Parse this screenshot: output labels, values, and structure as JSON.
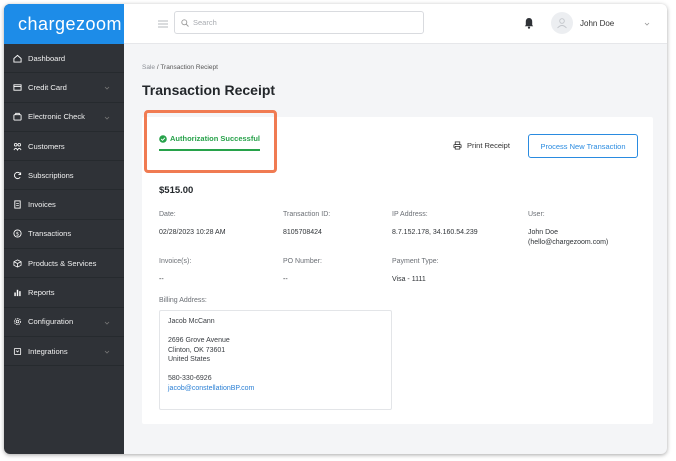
{
  "app": {
    "logo": "chargezoom"
  },
  "sidebar": {
    "items": [
      {
        "label": "Dashboard",
        "icon": "home-icon",
        "has_children": false
      },
      {
        "label": "Credit Card",
        "icon": "credit-card-icon",
        "has_children": true
      },
      {
        "label": "Electronic Check",
        "icon": "bank-icon",
        "has_children": true
      },
      {
        "label": "Customers",
        "icon": "customers-icon",
        "has_children": false
      },
      {
        "label": "Subscriptions",
        "icon": "refresh-icon",
        "has_children": false
      },
      {
        "label": "Invoices",
        "icon": "invoice-icon",
        "has_children": false
      },
      {
        "label": "Transactions",
        "icon": "dollar-icon",
        "has_children": false
      },
      {
        "label": "Products & Services",
        "icon": "box-icon",
        "has_children": false
      },
      {
        "label": "Reports",
        "icon": "bar-chart-icon",
        "has_children": false
      },
      {
        "label": "Configuration",
        "icon": "gear-icon",
        "has_children": true
      },
      {
        "label": "Integrations",
        "icon": "integrations-icon",
        "has_children": true
      }
    ]
  },
  "header": {
    "search_placeholder": "Search",
    "user_name": "John Doe"
  },
  "breadcrumb": {
    "root": "Sale",
    "separator": " / ",
    "current": "Transaction Reciept"
  },
  "page_title": "Transaction Receipt",
  "receipt": {
    "status": "Authorization Successful",
    "print_label": "Print Receipt",
    "process_label": "Process New Transaction",
    "amount": "$515.00",
    "fields": {
      "date_label": "Date:",
      "date": "02/28/2023 10:28 AM",
      "txn_label": "Transaction ID:",
      "txn": "8105708424",
      "ip_label": "IP Address:",
      "ip": "8.7.152.178, 34.160.54.239",
      "user_label": "User:",
      "user_line1": "John Doe",
      "user_line2": "(hello@chargezoom.com)",
      "invoice_label": "Invoice(s):",
      "invoice": "--",
      "po_label": "PO Number:",
      "po": "--",
      "payment_label": "Payment Type:",
      "payment": "Visa - 1111"
    },
    "billing": {
      "label": "Billing Address:",
      "name": "Jacob McCann",
      "street": "2696 Grove Avenue",
      "city": "Clinton, OK 73601",
      "country": "United States",
      "phone": "580-330-6926",
      "email": "jacob@constellationBP.com"
    }
  },
  "colors": {
    "accent": "#1d8ce8",
    "sidebar": "#2f3237",
    "success": "#27a24a",
    "highlight": "#f07b52"
  }
}
